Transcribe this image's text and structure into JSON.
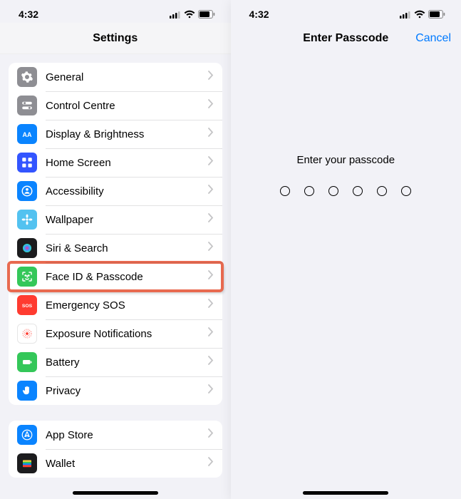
{
  "status": {
    "time": "4:32"
  },
  "settings": {
    "title": "Settings",
    "group1": [
      {
        "label": "General",
        "icon": "gear",
        "bg": "#8e8e93"
      },
      {
        "label": "Control Centre",
        "icon": "switches",
        "bg": "#8e8e93"
      },
      {
        "label": "Display & Brightness",
        "icon": "AA",
        "bg": "#0a84ff"
      },
      {
        "label": "Home Screen",
        "icon": "grid",
        "bg": "#3355ff"
      },
      {
        "label": "Accessibility",
        "icon": "person",
        "bg": "#0a84ff"
      },
      {
        "label": "Wallpaper",
        "icon": "flower",
        "bg": "#53c2f0"
      },
      {
        "label": "Siri & Search",
        "icon": "siri",
        "bg": "#1c1c1e"
      },
      {
        "label": "Face ID & Passcode",
        "icon": "face",
        "bg": "#34c759",
        "hl": true
      },
      {
        "label": "Emergency SOS",
        "icon": "SOS",
        "bg": "#ff3b30"
      },
      {
        "label": "Exposure Notifications",
        "icon": "burst",
        "bg": "#ffffff"
      },
      {
        "label": "Battery",
        "icon": "battery",
        "bg": "#34c759"
      },
      {
        "label": "Privacy",
        "icon": "hand",
        "bg": "#0a84ff"
      }
    ],
    "group2": [
      {
        "label": "App Store",
        "icon": "appstore",
        "bg": "#0a84ff"
      },
      {
        "label": "Wallet",
        "icon": "wallet",
        "bg": "#1c1c1e"
      }
    ]
  },
  "passcode": {
    "title": "Enter Passcode",
    "cancel": "Cancel",
    "prompt": "Enter your passcode",
    "digits": 6
  }
}
